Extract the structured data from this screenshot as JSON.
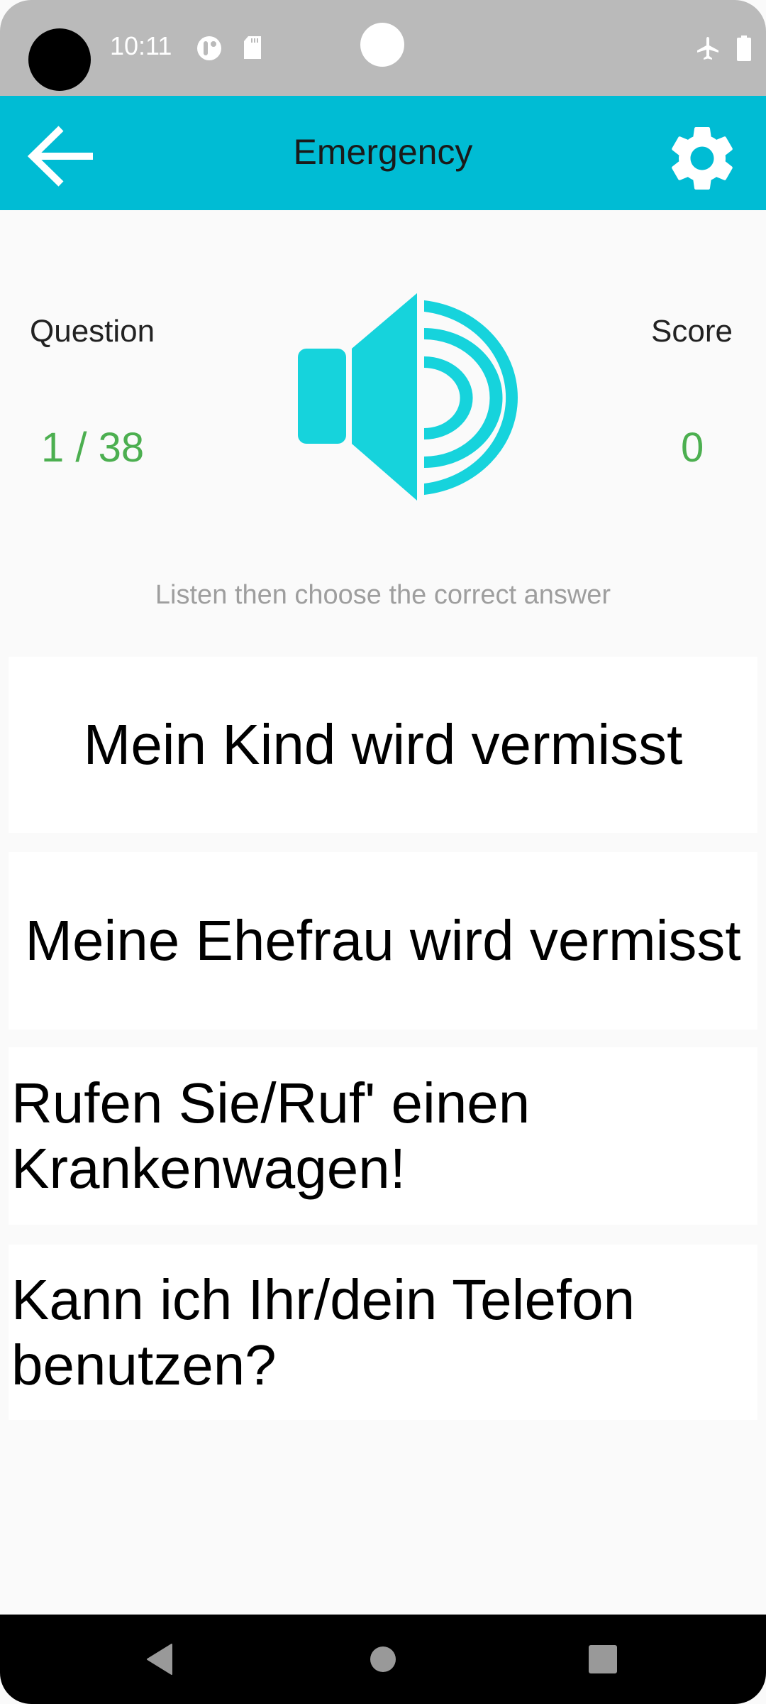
{
  "status_bar": {
    "time": "10:11",
    "icons": [
      "camera-cutout",
      "notification-app-icon",
      "sd-card-icon",
      "airplane-mode-icon",
      "battery-icon"
    ]
  },
  "app_bar": {
    "title": "Emergency",
    "back_icon": "arrow-left-icon",
    "settings_icon": "gear-icon",
    "background_color": "#00bcd4"
  },
  "quiz": {
    "question_label": "Question",
    "question_value": "1 / 38",
    "score_label": "Score",
    "score_value": "0",
    "speaker_icon": "speaker-icon",
    "accent_color": "#16d3dc",
    "value_color": "#4caf50",
    "instruction": "Listen then choose the correct answer"
  },
  "answers": [
    {
      "label": "Mein Kind wird vermisst"
    },
    {
      "label": "Meine Ehefrau wird vermisst"
    },
    {
      "label": "Rufen Sie/Ruf' einen Krankenwagen!"
    },
    {
      "label": "Kann ich Ihr/dein Telefon benutzen?"
    }
  ],
  "nav_bar": {
    "back": "back-triangle-icon",
    "home": "home-circle-icon",
    "recents": "recents-square-icon"
  }
}
